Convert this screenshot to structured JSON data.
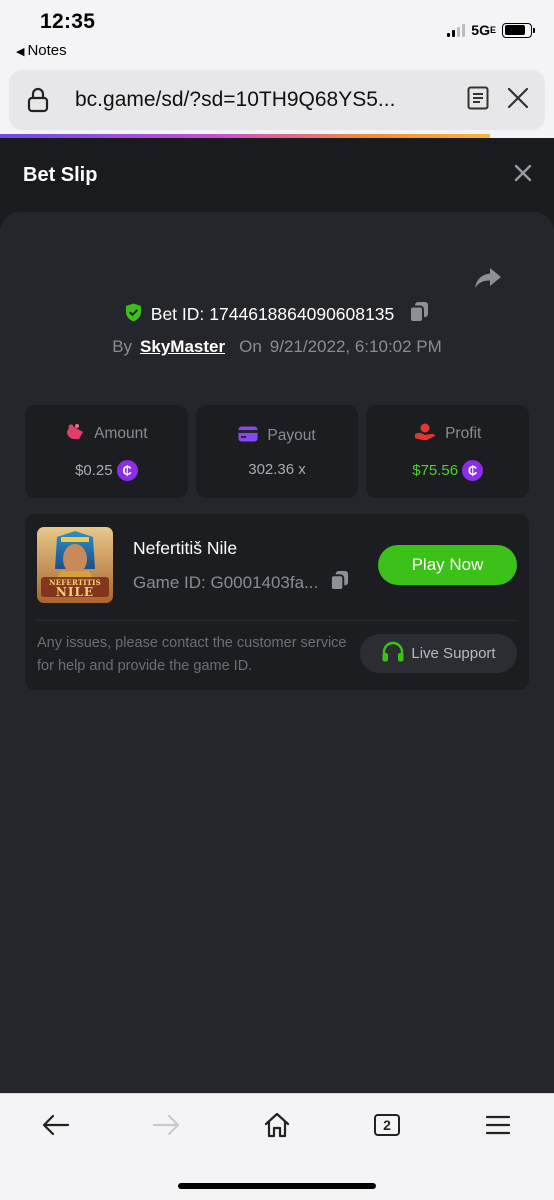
{
  "status_bar": {
    "time": "12:35",
    "back_app": "Notes",
    "network": "5G"
  },
  "browser": {
    "url": "bc.game/sd/?sd=10TH9Q68YS5...",
    "page_load_progress": 0.885,
    "tabs_count": "2"
  },
  "bet_slip": {
    "title": "Bet Slip",
    "bet_id_label": "Bet ID:",
    "bet_id": "1744618864090608135",
    "by_label": "By",
    "username": "SkyMaster",
    "on_label": "On",
    "datetime": "9/21/2022, 6:10:02 PM",
    "stats": [
      {
        "label": "Amount",
        "value": "$0.25",
        "icon": "amount-icon",
        "coin": true,
        "color": "#a8aab0"
      },
      {
        "label": "Payout",
        "value": "302.36 x",
        "icon": "payout-icon",
        "coin": false,
        "color": "#a8aab0"
      },
      {
        "label": "Profit",
        "value": "$75.56",
        "icon": "profit-icon",
        "coin": true,
        "color": "#4fd12b"
      }
    ],
    "coin_symbol": "₵",
    "game": {
      "name": "Nefertitiš Nile",
      "id_label": "Game ID:",
      "id_value": "G0001403fa...",
      "play_label": "Play Now",
      "thumb_text_top": "NEFERTITIS",
      "thumb_text_bottom": "NILE"
    },
    "notice": "Any issues, please contact the customer service for help and provide the game ID.",
    "support_label": "Live Support"
  },
  "colors": {
    "accent_green": "#3bc117",
    "profit_green": "#4fd12b",
    "coin_purple": "#8a2ee8",
    "panel_bg": "#25262b",
    "card_bg": "#1c1d21"
  }
}
